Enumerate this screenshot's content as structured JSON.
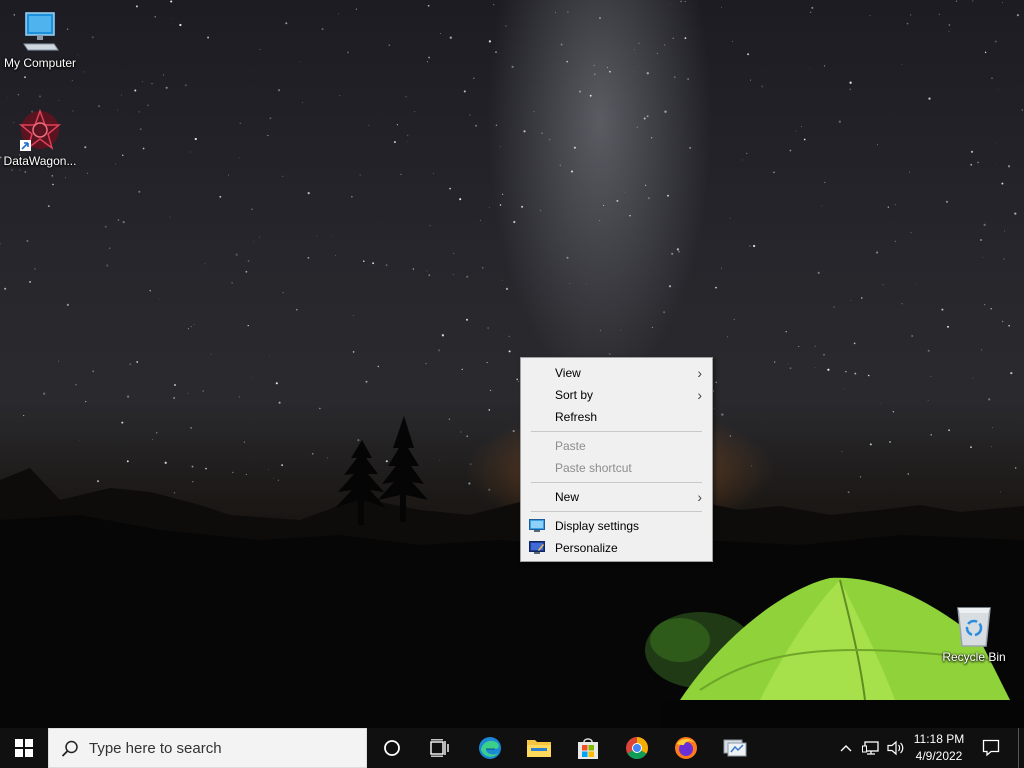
{
  "desktop": {
    "icons": [
      {
        "label": "My Computer",
        "icon": "computer-monitor-icon"
      },
      {
        "label": "DataWagon...",
        "icon": "datawagon-logo-icon"
      },
      {
        "label": "Recycle Bin",
        "icon": "recycle-bin-icon"
      }
    ]
  },
  "context_menu": {
    "items": [
      {
        "label": "View",
        "has_submenu": true,
        "enabled": true
      },
      {
        "label": "Sort by",
        "has_submenu": true,
        "enabled": true
      },
      {
        "label": "Refresh",
        "has_submenu": false,
        "enabled": true
      },
      {
        "label": "Paste",
        "has_submenu": false,
        "enabled": false
      },
      {
        "label": "Paste shortcut",
        "has_submenu": false,
        "enabled": false
      },
      {
        "label": "New",
        "has_submenu": true,
        "enabled": true
      },
      {
        "label": "Display settings",
        "icon": "display-settings-icon",
        "enabled": true
      },
      {
        "label": "Personalize",
        "icon": "personalize-icon",
        "enabled": true
      }
    ]
  },
  "taskbar": {
    "search_placeholder": "Type here to search",
    "pinned": [
      {
        "icon": "cortana-icon"
      },
      {
        "icon": "task-view-icon"
      },
      {
        "icon": "edge-icon"
      },
      {
        "icon": "file-explorer-icon"
      },
      {
        "icon": "store-icon"
      },
      {
        "icon": "chrome-icon"
      },
      {
        "icon": "firefox-icon"
      },
      {
        "icon": "network-app-icon"
      }
    ],
    "tray": {
      "time": "11:18 PM",
      "date": "4/9/2022"
    }
  },
  "colors": {
    "taskbar_bg": "#101010",
    "menu_bg": "#f0f0f0",
    "tent_green": "#8fd23a"
  }
}
